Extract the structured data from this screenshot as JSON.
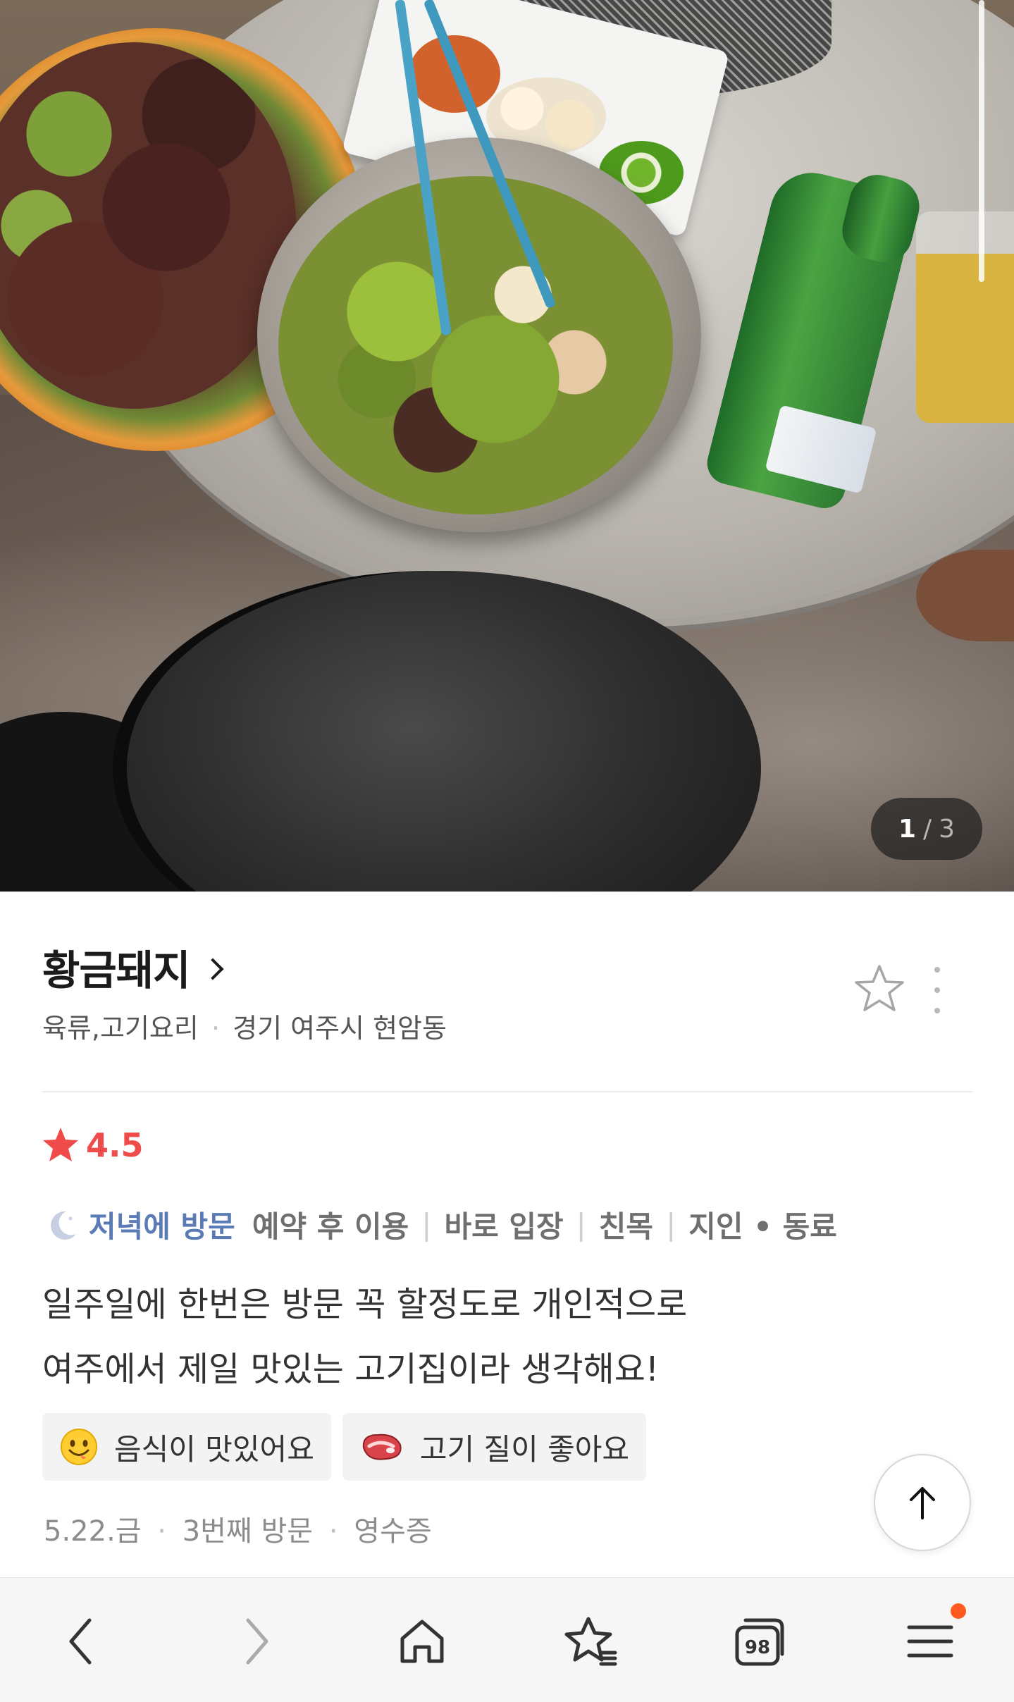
{
  "gallery": {
    "current": "1",
    "separator": "/",
    "total": "3"
  },
  "place": {
    "name": "황금돼지",
    "category": "육류,고기요리",
    "separator": "·",
    "location": "경기 여주시 현암동"
  },
  "rating": {
    "value": "4.5",
    "color": "#ef4b4b"
  },
  "visit_tags": {
    "time_label": "저녁에 방문",
    "tags": [
      "예약 후 이용",
      "바로 입장",
      "친목",
      "지인 • 동료"
    ],
    "divider": "|"
  },
  "review": {
    "line1": "일주일에 한번은 방문 꼭 할정도로 개인적으로",
    "line2": "여주에서 제일 맛있는 고기집이라 생각해요!"
  },
  "keywords": [
    {
      "icon": "smiley-face-icon",
      "label": "음식이 맛있어요"
    },
    {
      "icon": "steak-meat-icon",
      "label": "고기 질이 좋아요"
    }
  ],
  "meta": {
    "date": "5.22.금",
    "visit_count": "3번째 방문",
    "verification": "영수증",
    "separator": "·"
  },
  "nav": {
    "tabs_count": "98",
    "items": [
      "back-icon",
      "forward-icon",
      "home-icon",
      "bookmarks-icon",
      "tabs-icon",
      "menu-icon"
    ]
  }
}
